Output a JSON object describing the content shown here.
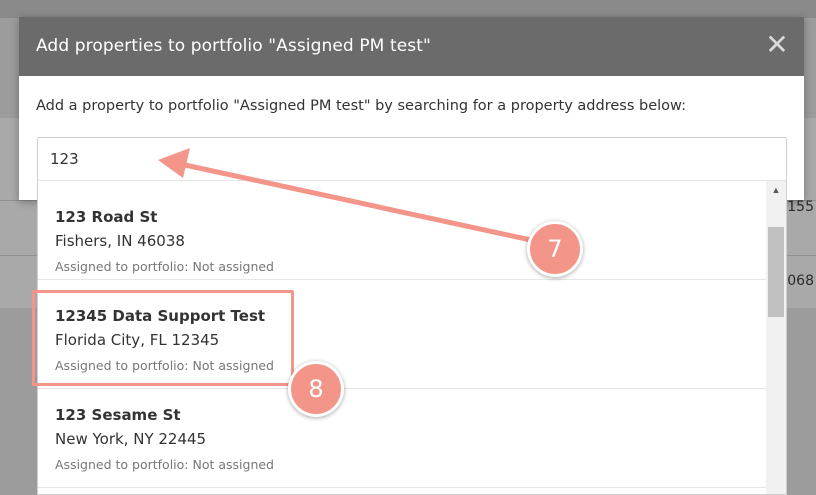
{
  "modal": {
    "title": "Add properties to portfolio \"Assigned PM test\"",
    "close_glyph": "✕",
    "description": "Add a property to portfolio \"Assigned PM test\" by searching for a property address below:"
  },
  "search": {
    "value": "123"
  },
  "background": {
    "cell_1": "155",
    "cell_2": "068"
  },
  "results": [
    {
      "name": "123 Road St",
      "city": "Fishers, IN 46038",
      "assigned": "Assigned to portfolio: Not assigned"
    },
    {
      "name": "12345 Data Support Test",
      "city": "Florida City, FL 12345",
      "assigned": "Assigned to portfolio: Not assigned"
    },
    {
      "name": "123 Sesame St",
      "city": "New York, NY 22445",
      "assigned": "Assigned to portfolio: Not assigned"
    }
  ],
  "scrollbar": {
    "up_glyph": "▲"
  },
  "annotations": {
    "step_7": "7",
    "step_8": "8",
    "accent_color": "#f4958a"
  }
}
